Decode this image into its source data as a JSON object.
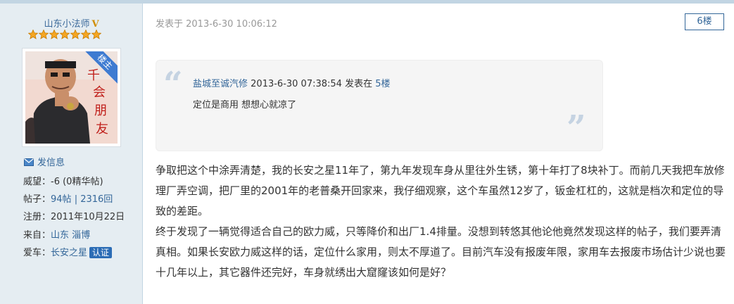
{
  "author": {
    "name": "山东小法师",
    "vip_mark": "V",
    "star_count": 7,
    "avatar_ribbon": "楼主",
    "send_message": "发信息",
    "stats": [
      {
        "label": "威望：",
        "value": "-6 (0精华帖)",
        "linked": false
      },
      {
        "label": "帖子：",
        "value": "94帖 | 2316回",
        "linked": true
      },
      {
        "label": "注册：",
        "value": "2011年10月22日",
        "linked": false
      },
      {
        "label": "来自：",
        "value": "山东 淄博",
        "linked": true
      },
      {
        "label": "爱车：",
        "value": "长安之星",
        "linked": true,
        "badge": "认证"
      }
    ]
  },
  "post": {
    "time": "发表于 2013-6-30 10:06:12",
    "floor": "6楼",
    "quote": {
      "author": "盐城至诚汽修",
      "time": " 2013-6-30 07:38:54 发表在 ",
      "floor": "5楼",
      "text": "定位是商用 想想心就凉了"
    },
    "paragraphs": [
      "争取把这个中涂弄清楚，我的长安之星11年了，第九年发现车身从里往外生锈，第十年打了8块补丁。而前几天我把车放修理厂弄空调，把厂里的2001年的老普桑开回家来，我仔细观察，这个车虽然12岁了，钣金杠杠的，这就是档次和定位的导致的差距。",
      "终于发现了一辆觉得适合自己的欧力威，只等降价和出厂1.4排量。没想到转悠其他论他竟然发现这样的帖子，我们要弄清真相。如果长安欧力威这样的话，定位什么家用，则太不厚道了。目前汽车没有报废年限，家用车去报废市场估计少说也要十几年以上，其它器件还完好，车身就绣出大窟窿该如何是好？"
    ]
  },
  "colors": {
    "sidebar_bg": "#e5edf2",
    "link": "#336699",
    "badge": "#2b6cb5",
    "star": "#f5a623"
  }
}
